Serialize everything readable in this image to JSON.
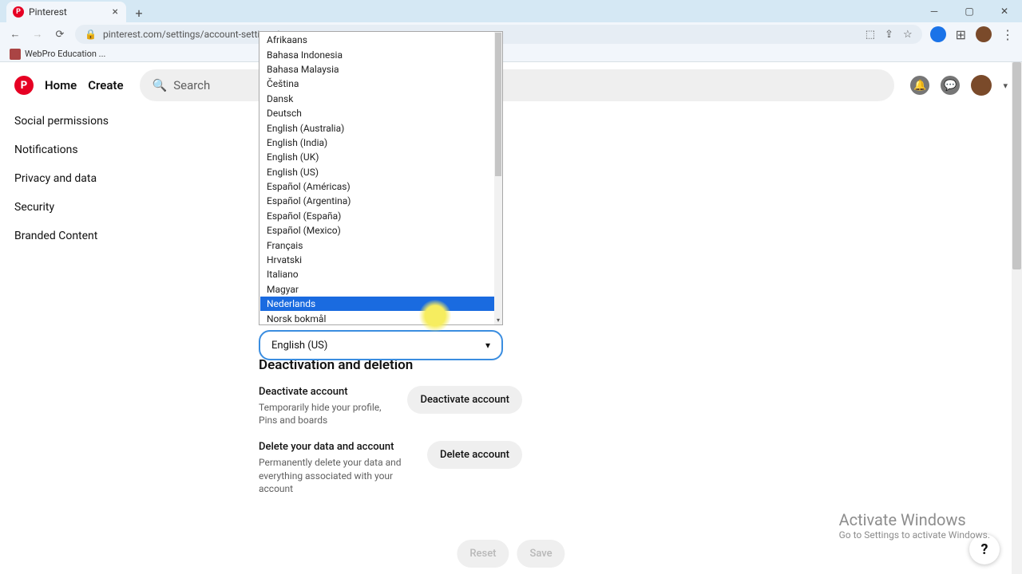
{
  "browser": {
    "tab_title": "Pinterest",
    "url": "pinterest.com/settings/account-settings/",
    "bookmark": "WebPro Education ..."
  },
  "header": {
    "home": "Home",
    "create": "Create",
    "search_placeholder": "Search"
  },
  "sidebar": {
    "items": [
      {
        "label": "Social permissions"
      },
      {
        "label": "Notifications"
      },
      {
        "label": "Privacy and data"
      },
      {
        "label": "Security"
      },
      {
        "label": "Branded Content"
      }
    ]
  },
  "language": {
    "selected": "English (US)",
    "options": [
      "Afrikaans",
      "Bahasa Indonesia",
      "Bahasa Malaysia",
      "Čeština",
      "Dansk",
      "Deutsch",
      "English (Australia)",
      "English (India)",
      "English (UK)",
      "English (US)",
      "Español (Américas)",
      "Español (Argentina)",
      "Español (España)",
      "Español (Mexico)",
      "Français",
      "Hrvatski",
      "Italiano",
      "Magyar",
      "Nederlands",
      "Norsk bokmål"
    ],
    "highlighted_index": 18
  },
  "deactivation": {
    "section_title": "Deactivation and deletion",
    "deactivate": {
      "label": "Deactivate account",
      "desc": "Temporarily hide your profile, Pins and boards",
      "button": "Deactivate account"
    },
    "delete": {
      "label": "Delete your data and account",
      "desc": "Permanently delete your data and everything associated with your account",
      "button": "Delete account"
    }
  },
  "actions": {
    "reset": "Reset",
    "save": "Save"
  },
  "watermark": {
    "title": "Activate Windows",
    "sub": "Go to Settings to activate Windows."
  },
  "help": "?"
}
